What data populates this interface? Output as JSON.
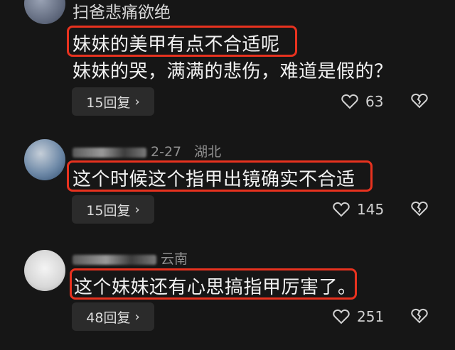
{
  "comments": [
    {
      "username": "扫爸悲痛欲绝",
      "highlight_text": "妹妹的美甲有点不合适呢",
      "extra_text": "妹妹的哭，满满的悲伤，难道是假的？",
      "reply_label": "15回复",
      "likes": "63"
    },
    {
      "date": "2-27",
      "location": "湖北",
      "highlight_text": "这个时候这个指甲出镜确实不合适",
      "reply_label": "15回复",
      "likes": "145"
    },
    {
      "location": "云南",
      "highlight_text": "这个妹妹还有心思搞指甲厉害了。",
      "reply_label": "48回复",
      "likes": "251"
    }
  ],
  "icons": {
    "chevron": "chevron-right-icon",
    "like": "heart-outline-icon",
    "dislike": "broken-heart-icon"
  },
  "colors": {
    "highlight": "#e8321f",
    "background": "#161616"
  }
}
